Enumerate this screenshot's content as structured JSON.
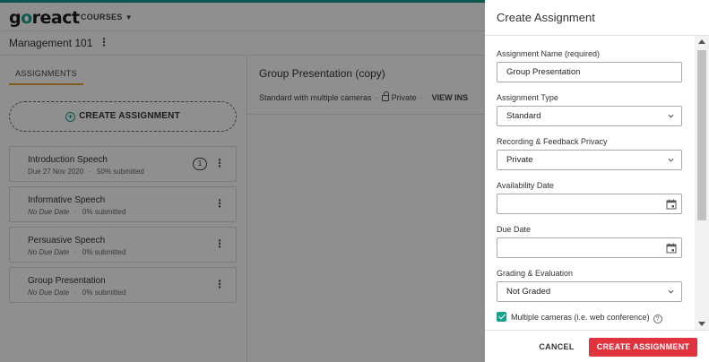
{
  "app": {
    "logo_prefix": "g",
    "logo_o": "o",
    "logo_suffix": "react",
    "courses_label": "COURSES"
  },
  "course": {
    "title": "Management 101"
  },
  "left_pane": {
    "tab_label": "ASSIGNMENTS",
    "create_label": "CREATE ASSIGNMENT",
    "assignments": [
      {
        "name": "Introduction Speech",
        "due": "Due 27 Nov 2020",
        "submitted": "50% submitted",
        "badge": "1"
      },
      {
        "name": "Informative Speech",
        "due": "No Due Date",
        "submitted": "0% submitted"
      },
      {
        "name": "Persuasive Speech",
        "due": "No Due Date",
        "submitted": "0% submitted"
      },
      {
        "name": "Group Presentation",
        "due": "No Due Date",
        "submitted": "0% submitted"
      }
    ]
  },
  "right_pane": {
    "title": "Group Presentation (copy)",
    "type_text": "Standard with multiple cameras",
    "privacy_text": "Private",
    "view_text": "VIEW INS"
  },
  "modal": {
    "title": "Create Assignment",
    "fields": {
      "name_label": "Assignment Name (required)",
      "name_value": "Group Presentation",
      "type_label": "Assignment Type",
      "type_value": "Standard",
      "privacy_label": "Recording & Feedback Privacy",
      "privacy_value": "Private",
      "availability_label": "Availability Date",
      "availability_value": "",
      "due_label": "Due Date",
      "due_value": "",
      "grading_label": "Grading & Evaluation",
      "grading_value": "Not Graded",
      "multi_cam_label": "Multiple cameras (i.e. web conference)"
    },
    "cancel_label": "CANCEL",
    "create_label": "CREATE ASSIGNMENT"
  },
  "colors": {
    "accent_teal": "#1a9e8f",
    "tab_underline": "#e8a23a",
    "primary_red": "#e0333e"
  }
}
